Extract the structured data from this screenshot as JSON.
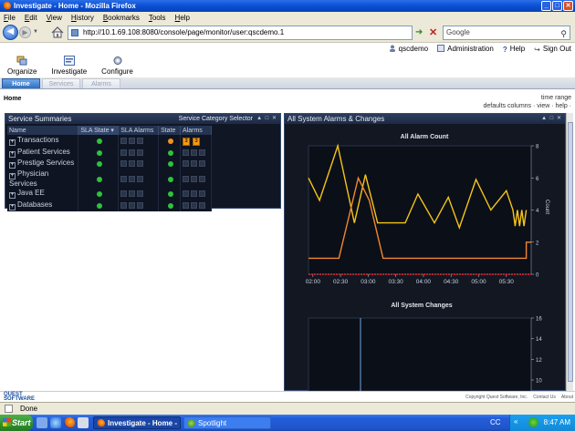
{
  "window": {
    "title": "Investigate - Home - Mozilla Firefox"
  },
  "menu": [
    "File",
    "Edit",
    "View",
    "History",
    "Bookmarks",
    "Tools",
    "Help"
  ],
  "nav": {
    "url": "http://10.1.69.108:8080/console/page/monitor/user:qscdemo.1",
    "search_placeholder": "Google"
  },
  "app_header": {
    "user": "qscdemo",
    "administration": "Administration",
    "help": "Help",
    "sign_out": "Sign Out"
  },
  "tools": [
    {
      "label": "Organize"
    },
    {
      "label": "Investigate"
    },
    {
      "label": "Configure"
    }
  ],
  "tabs": [
    {
      "label": "Home",
      "active": true
    },
    {
      "label": "Services",
      "active": false
    },
    {
      "label": "Alarms",
      "active": false
    }
  ],
  "page": {
    "title": "Home",
    "time_range": "time range",
    "links": "defaults  columns  ·  view  ·  help  ·"
  },
  "service_panel": {
    "title": "Service Summaries",
    "selector": "Service Category Selector",
    "columns": [
      "Name",
      "SLA State ▾",
      "SLA Alarms",
      "State",
      "Alarms"
    ],
    "rows": [
      {
        "name": "Transactions",
        "state": "orange",
        "alarms": [
          "3",
          "3"
        ]
      },
      {
        "name": "Patient Services",
        "state": "green",
        "alarms": []
      },
      {
        "name": "Prestige Services",
        "state": "green",
        "alarms": []
      },
      {
        "name": "Physician Services",
        "state": "green",
        "alarms": []
      },
      {
        "name": "Java EE",
        "state": "green",
        "alarms": []
      },
      {
        "name": "Databases",
        "state": "green",
        "alarms": []
      }
    ]
  },
  "alarm_panel": {
    "title": "All System Alarms & Changes"
  },
  "footer": {
    "logo_top": "QUEST",
    "logo_bottom": "SOFTWARE",
    "copyright": "Copyright Quest Software, Inc.",
    "contact": "Contact Us",
    "about": "About"
  },
  "status": {
    "text": "Done"
  },
  "taskbar": {
    "start": "Start",
    "tasks": [
      {
        "label": "Investigate - Home - ...",
        "active": true
      },
      {
        "label": "Spotlight",
        "active": false
      }
    ],
    "cc": "CC",
    "clock": "8:47 AM"
  },
  "colors": {
    "alarm_line": "#f5c518",
    "alarm_line_2": "#f0872e",
    "zero_line": "#e0282e",
    "green_state": "#2dc43b",
    "orange_state": "#f4911e"
  },
  "chart_data": [
    {
      "type": "line",
      "title": "All Alarm Count",
      "ylabel": "Count",
      "x_ticks": [
        "02:00",
        "02:30",
        "03:00",
        "03:30",
        "04:00",
        "04:30",
        "05:00",
        "05:30"
      ],
      "ylim": [
        0,
        8
      ],
      "y_ticks": [
        "0",
        "2",
        "4",
        "6",
        "8"
      ],
      "grid": false,
      "series": [
        {
          "color": "#f5c518",
          "points": [
            [
              1.92,
              6
            ],
            [
              2.12,
              4.6
            ],
            [
              2.45,
              8
            ],
            [
              2.75,
              3.2
            ],
            [
              2.95,
              6.2
            ],
            [
              3.17,
              3.2
            ],
            [
              3.67,
              3.2
            ],
            [
              3.9,
              5
            ],
            [
              4.2,
              3.2
            ],
            [
              4.45,
              4.8
            ],
            [
              4.65,
              2.9
            ],
            [
              4.95,
              5.9
            ],
            [
              5.22,
              4.0
            ],
            [
              5.5,
              5.2
            ],
            [
              5.62,
              4.0
            ],
            [
              5.66,
              3.0
            ],
            [
              5.7,
              4.0
            ],
            [
              5.74,
              3.0
            ],
            [
              5.78,
              4.0
            ],
            [
              5.82,
              3.0
            ],
            [
              5.86,
              4.0
            ]
          ]
        },
        {
          "color": "#f0872e",
          "points": [
            [
              1.92,
              1
            ],
            [
              2.47,
              1
            ],
            [
              2.82,
              6
            ],
            [
              3.02,
              4.6
            ],
            [
              3.27,
              1
            ],
            [
              5.86,
              1
            ],
            [
              5.86,
              2
            ],
            [
              5.95,
              2
            ]
          ]
        },
        {
          "color": "#e0282e",
          "points": [
            [
              1.92,
              0
            ],
            [
              5.95,
              0
            ]
          ]
        }
      ]
    },
    {
      "type": "line",
      "title": "All System Changes",
      "ylim": [
        10,
        16
      ],
      "y_ticks": [
        "10",
        "12",
        "14",
        "16"
      ],
      "grid": false,
      "series": []
    }
  ]
}
